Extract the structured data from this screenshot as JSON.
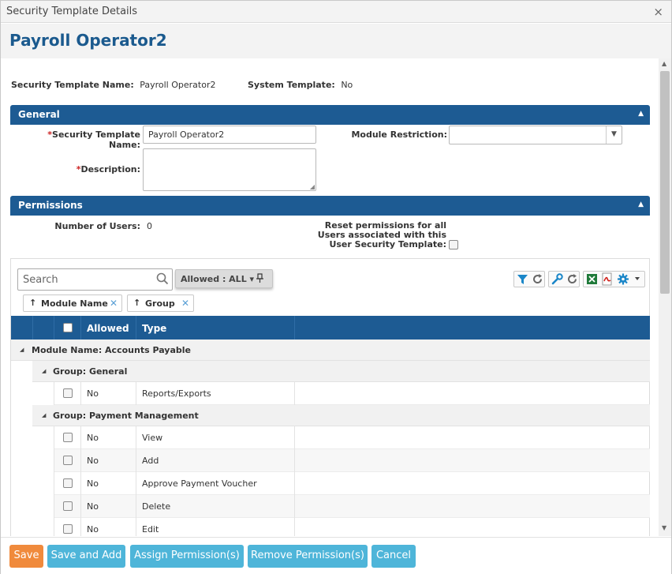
{
  "window": {
    "title": "Security Template Details",
    "close_glyph": "×"
  },
  "page_title": "Payroll Operator2",
  "info": {
    "name_label": "Security Template Name:",
    "name_value": "Payroll Operator2",
    "system_label": "System Template:",
    "system_value": "No"
  },
  "general": {
    "header": "General",
    "template_name_label": "Security Template Name:",
    "template_name_value": "Payroll Operator2",
    "required_mark": "*",
    "module_restriction_label": "Module Restriction:",
    "module_restriction_value": "",
    "description_label": "Description:",
    "description_value": ""
  },
  "permissions": {
    "header": "Permissions",
    "users_label": "Number of Users:",
    "users_value": "0",
    "reset_label_line1": "Reset permissions for all",
    "reset_label_line2": "Users associated with this",
    "reset_label_line3": "User Security Template:"
  },
  "grid": {
    "search_placeholder": "Search",
    "filter_label": "Allowed : ALL ▾",
    "groupings": [
      "Module Name",
      "Group"
    ],
    "columns": [
      "Allowed",
      "Type"
    ],
    "module_group": "Module Name: Accounts Payable",
    "groups": [
      {
        "label": "Group: General",
        "rows": [
          {
            "allowed": "No",
            "type": "Reports/Exports"
          }
        ]
      },
      {
        "label": "Group: Payment Management",
        "rows": [
          {
            "allowed": "No",
            "type": "View"
          },
          {
            "allowed": "No",
            "type": "Add"
          },
          {
            "allowed": "No",
            "type": "Approve Payment Voucher"
          },
          {
            "allowed": "No",
            "type": "Delete"
          },
          {
            "allowed": "No",
            "type": "Edit"
          }
        ]
      }
    ]
  },
  "toolbar_icons": [
    "filter-icon",
    "refresh-icon",
    "wrench-icon",
    "refresh-icon",
    "excel-icon",
    "pdf-icon",
    "gear-icon"
  ],
  "footer": {
    "save": "Save",
    "save_add": "Save and Add",
    "assign": "Assign Permission(s)",
    "remove": "Remove Permission(s)",
    "cancel": "Cancel"
  },
  "colors": {
    "brand_blue": "#1d5b93",
    "title_blue": "#1b5a8e",
    "save_orange": "#f08a3c",
    "button_blue": "#4eb5d9"
  }
}
